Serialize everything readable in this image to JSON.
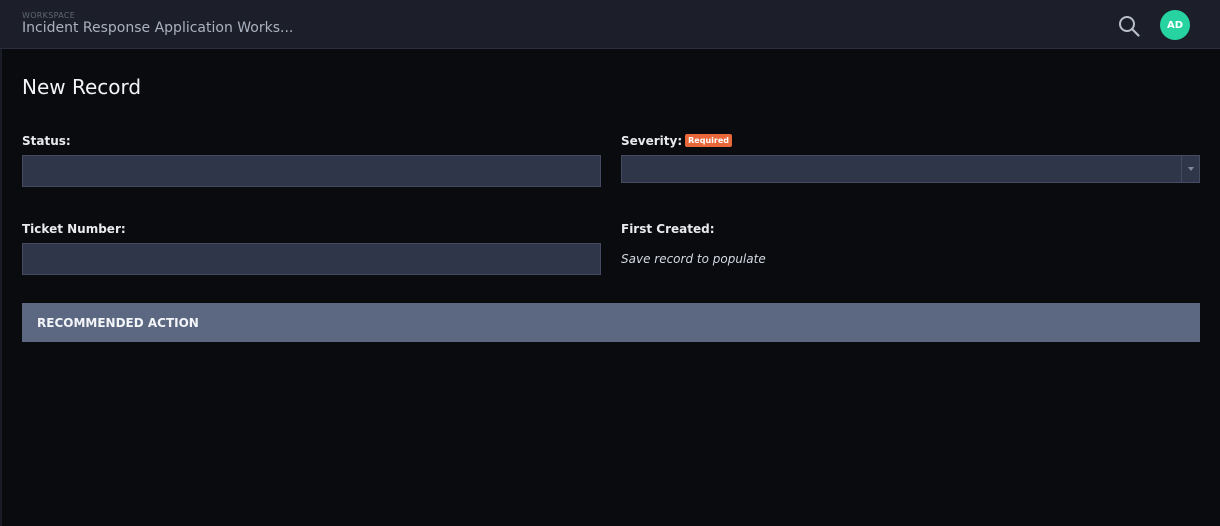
{
  "header": {
    "workspace_label": "WORKSPACE",
    "workspace_name": "Incident Response Application Works...",
    "avatar_initials": "AD",
    "avatar_color": "#27d3a0",
    "search_icon": "search-icon"
  },
  "form": {
    "title": "New Record",
    "status_label": "Status:",
    "status_value": "",
    "severity_label": "Severity:",
    "severity_required_badge": "Required",
    "severity_value": "",
    "ticket_label": "Ticket Number:",
    "ticket_value": "",
    "first_created_label": "First Created:",
    "first_created_hint": "Save record to populate"
  },
  "sections": {
    "recommended_action": "RECOMMENDED ACTION"
  },
  "colors": {
    "background": "#090b0f",
    "topbar": "#1c1f2a",
    "input_bg": "#30364a",
    "section_header_bg": "#5c6882",
    "required_badge": "#e8683a"
  }
}
